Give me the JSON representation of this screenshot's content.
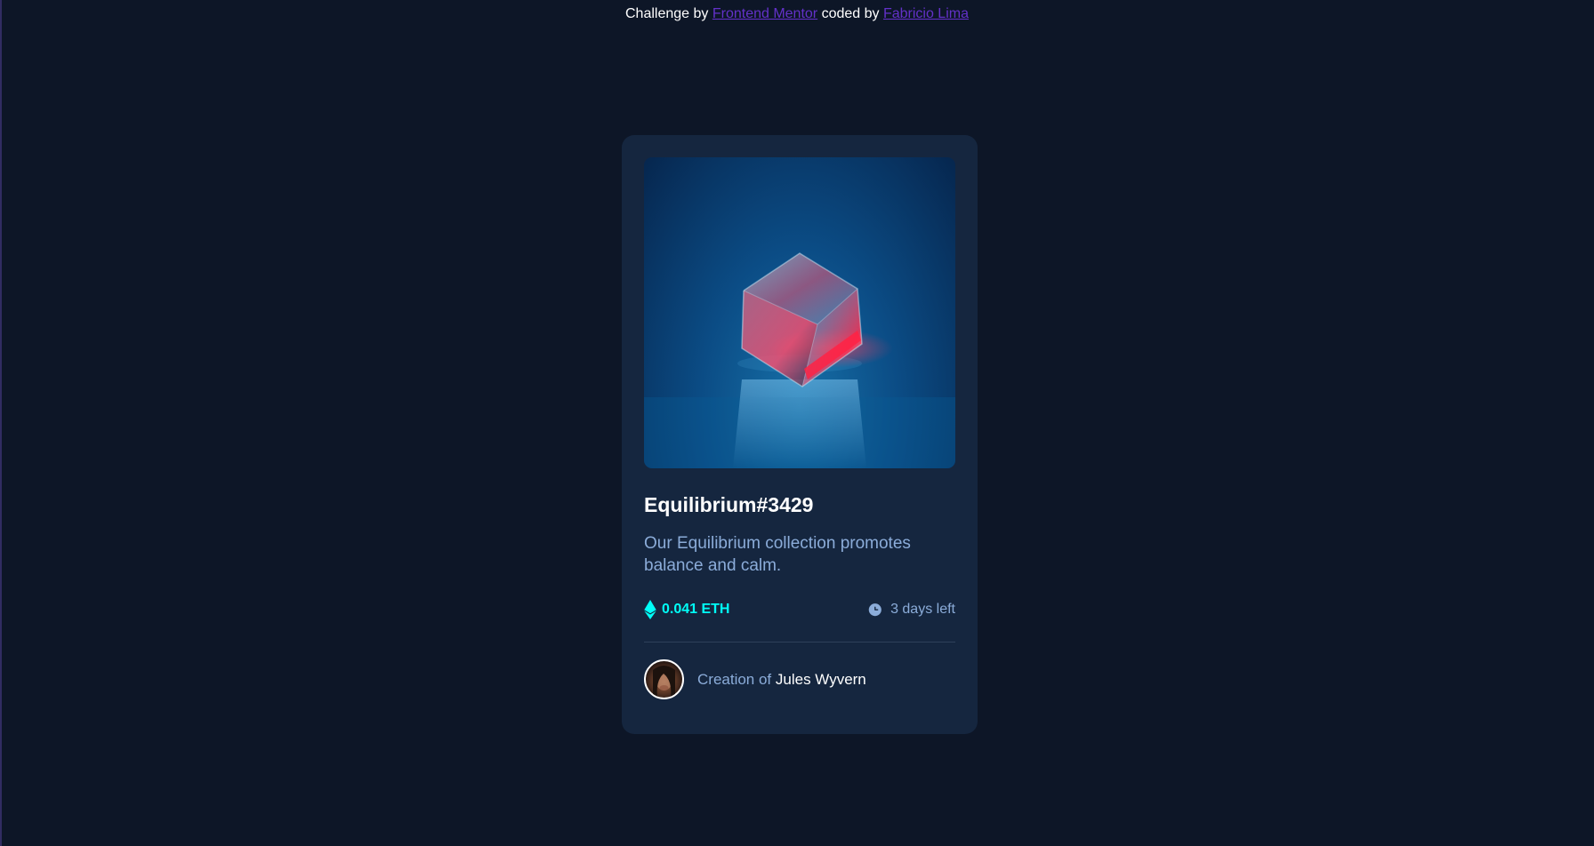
{
  "attribution": {
    "prefix": "Challenge by ",
    "link1": "Frontend Mentor",
    "middle": " coded by ",
    "link2": "Fabricio Lima"
  },
  "card": {
    "image_alt": "Equilibrium crystal cube",
    "title": "Equilibrium#3429",
    "description": "Our Equilibrium collection promotes balance and calm.",
    "price": "0.041 ETH",
    "price_icon": "ethereum-icon",
    "time_left": "3 days left",
    "time_icon": "clock-icon",
    "creator_prefix": "Creation of ",
    "creator_name": "Jules Wyvern"
  },
  "colors": {
    "background": "#0d1627",
    "card": "#15263f",
    "accent_cyan": "#00fff8",
    "soft_blue": "#8bacd9",
    "link_purple": "#6331c9"
  }
}
